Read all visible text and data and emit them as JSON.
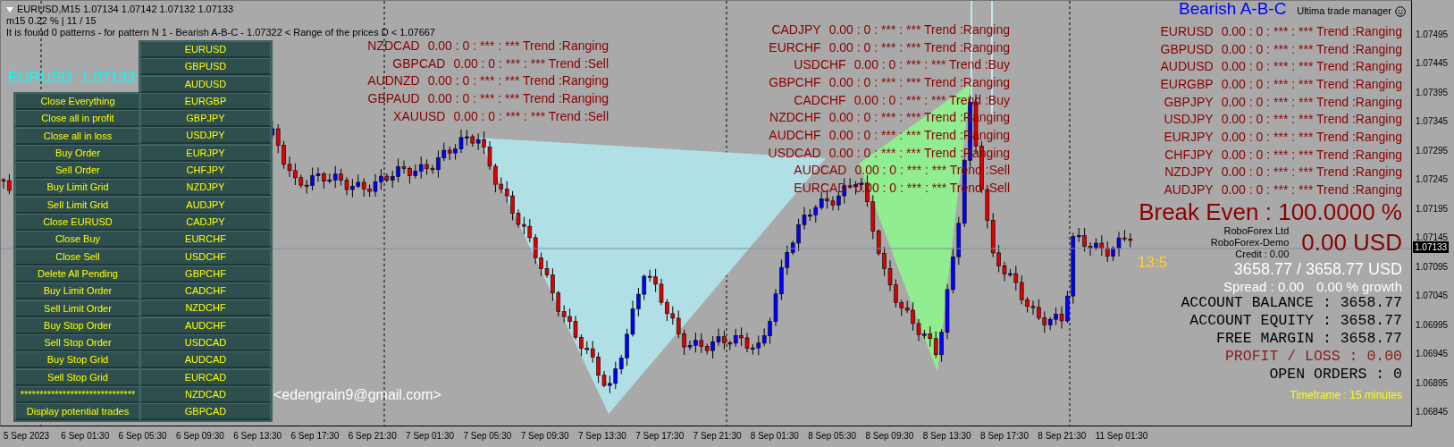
{
  "header": {
    "symbol_line": "EURUSD,M15  1.07134 1.07142 1.07132 1.07133",
    "stats": "m15  0.22 % | 11 / 15",
    "pattern_message": "It is found 0 patterns  -  for pattern N 1 - Bearish A-B-C  - 1.07322 < Range of the prices D < 1.07667"
  },
  "indicator_name": "Ultima trade manager",
  "pattern_title": "Bearish A-B-C",
  "action_buttons": [
    "Close Everything",
    "Close all in profit",
    "Close all in loss",
    "Buy Order",
    "Sell Order",
    "Buy Limit Grid",
    "Sell Limit Grid",
    "Close EURUSD",
    "Close Buy",
    "Close Sell",
    "Delete All Pending",
    "Buy Limit Order",
    "Sell Limit Order",
    "Buy Stop Order",
    "Sell Stop Order",
    "Buy Stop Grid",
    "Sell Stop Grid",
    "******************************",
    "Display potential trades"
  ],
  "symbol_buttons": [
    "EURUSD",
    "GBPUSD",
    "AUDUSD",
    "EURGBP",
    "GBPJPY",
    "USDJPY",
    "EURJPY",
    "CHFJPY",
    "NZDJPY",
    "AUDJPY",
    "CADJPY",
    "EURCHF",
    "USDCHF",
    "GBPCHF",
    "CADCHF",
    "NZDCHF",
    "AUDCHF",
    "USDCAD",
    "AUDCAD",
    "EURCAD",
    "NZDCAD",
    "GBPCAD"
  ],
  "price_label": {
    "symbol": "EURUSD",
    "price": "1.07133"
  },
  "trend_tables": [
    [
      {
        "symbol": "NZDCAD",
        "text": "0.00 : 0 : *** : *** Trend :Ranging"
      },
      {
        "symbol": "GBPCAD",
        "text": "0.00 : 0 : *** : *** Trend :Sell"
      },
      {
        "symbol": "AUDNZD",
        "text": "0.00 : 0 : *** : *** Trend :Ranging"
      },
      {
        "symbol": "GBPAUD",
        "text": "0.00 : 0 : *** : *** Trend :Ranging"
      },
      {
        "symbol": "XAUUSD",
        "text": "0.00 : 0 : *** : *** Trend :Sell"
      }
    ],
    [
      {
        "symbol": "CADJPY",
        "text": "0.00 : 0 : *** : *** Trend :Ranging"
      },
      {
        "symbol": "EURCHF",
        "text": "0.00 : 0 : *** : *** Trend :Ranging"
      },
      {
        "symbol": "USDCHF",
        "text": "0.00 : 0 : *** : *** Trend :Buy"
      },
      {
        "symbol": "GBPCHF",
        "text": "0.00 : 0 : *** : *** Trend :Ranging"
      },
      {
        "symbol": "CADCHF",
        "text": "0.00 : 0 : *** : *** Trend :Buy"
      },
      {
        "symbol": "NZDCHF",
        "text": "0.00 : 0 : *** : *** Trend :Ranging"
      },
      {
        "symbol": "AUDCHF",
        "text": "0.00 : 0 : *** : *** Trend :Ranging"
      },
      {
        "symbol": "USDCAD",
        "text": "0.00 : 0 : *** : *** Trend :Ranging"
      },
      {
        "symbol": "AUDCAD",
        "text": "0.00 : 0 : *** : *** Trend :Sell"
      },
      {
        "symbol": "EURCAD",
        "text": "0.00 : 0 : *** : *** Trend :Sell"
      }
    ],
    [
      {
        "symbol": "EURUSD",
        "text": "0.00 : 0 : *** : *** Trend :Ranging"
      },
      {
        "symbol": "GBPUSD",
        "text": "0.00 : 0 : *** : *** Trend :Ranging"
      },
      {
        "symbol": "AUDUSD",
        "text": "0.00 : 0 : *** : *** Trend :Ranging"
      },
      {
        "symbol": "EURGBP",
        "text": "0.00 : 0 : *** : *** Trend :Ranging"
      },
      {
        "symbol": "GBPJPY",
        "text": "0.00 : 0 : *** : *** Trend :Ranging"
      },
      {
        "symbol": "USDJPY",
        "text": "0.00 : 0 : *** : *** Trend :Ranging"
      },
      {
        "symbol": "EURJPY",
        "text": "0.00 : 0 : *** : *** Trend :Ranging"
      },
      {
        "symbol": "CHFJPY",
        "text": "0.00 : 0 : *** : *** Trend :Ranging"
      },
      {
        "symbol": "NZDJPY",
        "text": "0.00 : 0 : *** : *** Trend :Ranging"
      },
      {
        "symbol": "AUDJPY",
        "text": "0.00 : 0 : *** : *** Trend :Ranging"
      }
    ]
  ],
  "countdown": "13:5",
  "email": "<edengrain9@gmail.com>",
  "account": {
    "break_even": "Break Even : 100.0000 %",
    "result": "0.00 USD",
    "broker_lines": [
      "RoboForex Ltd",
      "RoboForex-Demo",
      "Credit : 0.00"
    ],
    "balance_equity": "3658.77 / 3658.77 USD",
    "spread": "Spread : 0.00",
    "growth": "0.00 % growth",
    "lines": [
      {
        "text": "ACCOUNT BALANCE : 3658.77",
        "color": "#000000"
      },
      {
        "text": "ACCOUNT EQUITY : 3658.77",
        "color": "#000000"
      },
      {
        "text": "FREE MARGIN : 3658.77",
        "color": "#000000"
      },
      {
        "text": "PROFIT / LOSS : 0.00",
        "color": "#8b1a1a"
      },
      {
        "text": "OPEN ORDERS : 0",
        "color": "#000000"
      }
    ],
    "timeframe": "Timeframe : 15 minutes"
  },
  "price_axis": {
    "ticks": [
      "1.07495",
      "1.07445",
      "1.07395",
      "1.07345",
      "1.07295",
      "1.07245",
      "1.07195",
      "1.07145",
      "1.07095",
      "1.07045",
      "1.06995",
      "1.06945",
      "1.06895",
      "1.06845"
    ],
    "current": "1.07133"
  },
  "time_axis": [
    "5 Sep 2023",
    "6 Sep 01:30",
    "6 Sep 05:30",
    "6 Sep 09:30",
    "6 Sep 13:30",
    "6 Sep 17:30",
    "6 Sep 21:30",
    "7 Sep 01:30",
    "7 Sep 05:30",
    "7 Sep 09:30",
    "7 Sep 13:30",
    "7 Sep 17:30",
    "7 Sep 21:30",
    "8 Sep 01:30",
    "8 Sep 05:30",
    "8 Sep 09:30",
    "8 Sep 13:30",
    "8 Sep 17:30",
    "8 Sep 21:30",
    "11 Sep 01:30"
  ]
}
